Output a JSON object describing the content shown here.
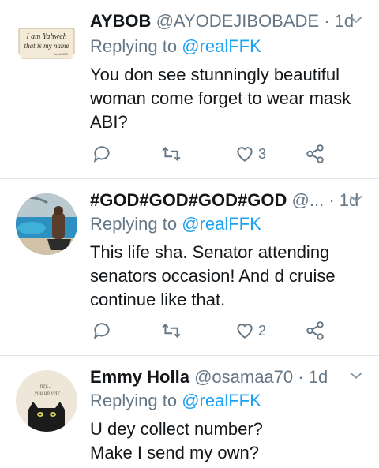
{
  "tweets": [
    {
      "name": "AYBOB",
      "handle": "@AYODEJIBOBADE",
      "time": "1d",
      "replying_prefix": "Replying to",
      "replying_to": "@realFFK",
      "lines": [
        "You don see stunningly beautiful",
        "woman come forget to wear mask",
        "ABI?"
      ],
      "likes": "3",
      "avatar": {
        "kind": "scripture-card",
        "line1": "I am Yahweh",
        "line2": "that is my name",
        "ref": "Isaiah 42:8"
      }
    },
    {
      "name": "#GOD#GOD#GOD#GOD",
      "handle": "@...",
      "time": "1d",
      "replying_prefix": "Replying to",
      "replying_to": "@realFFK",
      "lines": [
        "This life sha. Senator attending",
        "senators occasion! And d cruise",
        "continue like that."
      ],
      "likes": "2",
      "avatar": {
        "kind": "pool-photo"
      }
    },
    {
      "name": "Emmy Holla",
      "handle": "@osamaa70",
      "time": "1d",
      "replying_prefix": "Replying to",
      "replying_to": "@realFFK",
      "lines": [
        "U dey collect number?",
        "Make I send my own?"
      ],
      "likes": "",
      "avatar": {
        "kind": "cat-card",
        "text1": "hey...",
        "text2": "you up yet?"
      }
    }
  ],
  "icons": {
    "reply": "reply-icon",
    "retweet": "retweet-icon",
    "like": "heart-icon",
    "share": "share-icon",
    "caret": "chevron-down-icon"
  },
  "colors": {
    "text": "#14171a",
    "muted": "#657786",
    "link": "#1da1f2",
    "divider": "#e1e8ed"
  }
}
